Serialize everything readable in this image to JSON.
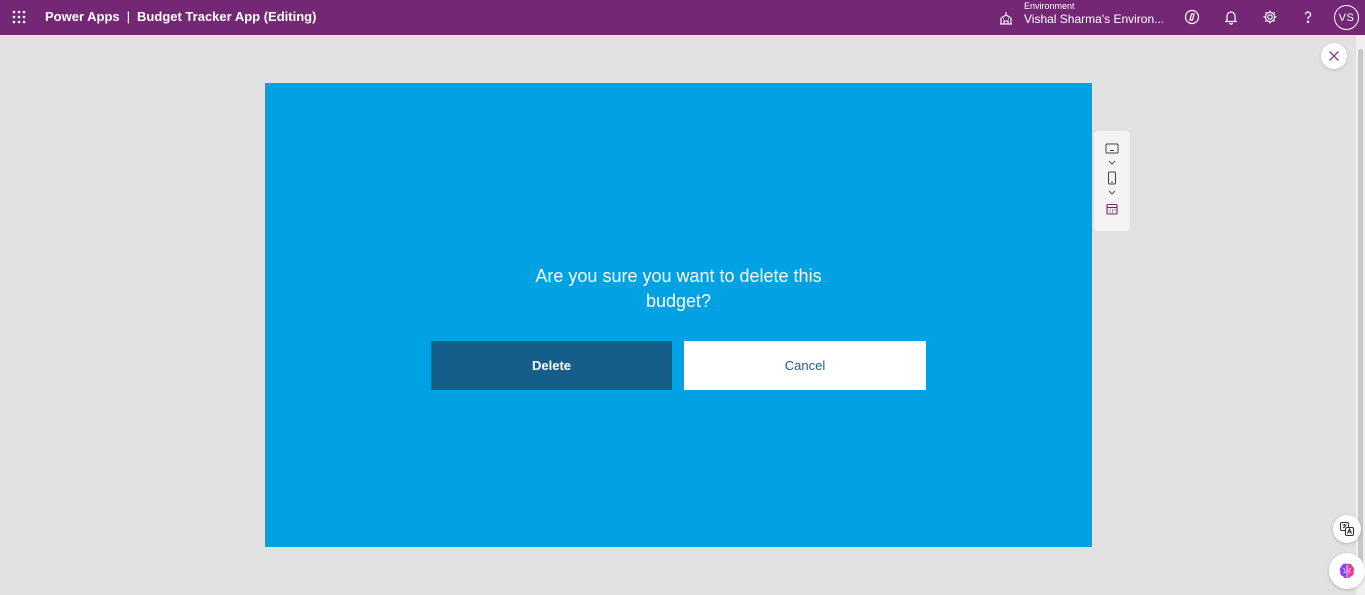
{
  "header": {
    "product": "Power Apps",
    "separator": "|",
    "app_title": "Budget Tracker App (Editing)",
    "environment_label": "Environment",
    "environment_name": "Vishal Sharma's Environ...",
    "avatar_initials": "VS",
    "background_color": "#742774"
  },
  "dialog": {
    "question": "Are you sure you want to delete this budget?",
    "delete_label": "Delete",
    "cancel_label": "Cancel",
    "canvas_color": "#00a2e4",
    "delete_color": "#155d8a"
  },
  "icons": {
    "waffle": "waffle-icon",
    "environment": "environment-icon",
    "copilot": "copilot-icon",
    "notifications": "bell-icon",
    "settings": "gear-icon",
    "help": "help-icon",
    "close": "close-icon",
    "desktop": "desktop-icon",
    "phone": "phone-icon",
    "calendar": "calendar-icon",
    "translate": "translate-icon",
    "brain": "brain-icon"
  }
}
